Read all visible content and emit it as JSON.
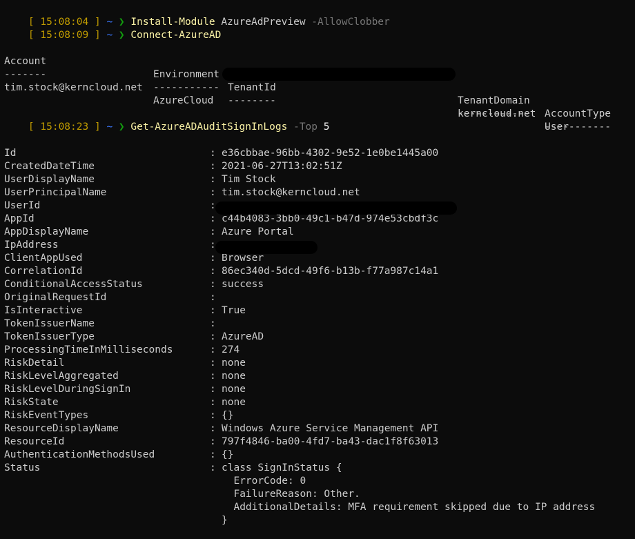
{
  "prompt": {
    "open": "[ ",
    "close": " ]",
    "tilde": "~",
    "arrow": "❯"
  },
  "commands": [
    {
      "time": "15:08:04",
      "cmdlet": "Install-Module",
      "args": "AzureAdPreview",
      "param": "-AllowClobber",
      "param_value": ""
    },
    {
      "time": "15:08:09",
      "cmdlet": "Connect-AzureAD",
      "args": "",
      "param": "",
      "param_value": ""
    },
    {
      "time": "15:08:23",
      "cmdlet": "Get-AzureADAuditSignInLogs",
      "args": "",
      "param": "-Top",
      "param_value": "5"
    }
  ],
  "account_table": {
    "headers": [
      "Account",
      "Environment",
      "TenantId",
      "TenantDomain",
      "AccountType"
    ],
    "underlines": [
      "-------",
      "-----------",
      "--------",
      "------------",
      "-----------"
    ],
    "row": [
      "tim.stock@kerncloud.net",
      "AzureCloud",
      "",
      "kerncloud.net",
      "User"
    ]
  },
  "signin": {
    "separator": ":",
    "fields": [
      {
        "key": "Id",
        "value": "e36cbbae-96bb-4302-9e52-1e0be1445a00"
      },
      {
        "key": "CreatedDateTime",
        "value": "2021-06-27T13:02:51Z"
      },
      {
        "key": "UserDisplayName",
        "value": "Tim Stock"
      },
      {
        "key": "UserPrincipalName",
        "value": "tim.stock@kerncloud.net"
      },
      {
        "key": "UserId",
        "value": ""
      },
      {
        "key": "AppId",
        "value": "c44b4083-3bb0-49c1-b47d-974e53cbdf3c"
      },
      {
        "key": "AppDisplayName",
        "value": "Azure Portal"
      },
      {
        "key": "IpAddress",
        "value": ""
      },
      {
        "key": "ClientAppUsed",
        "value": "Browser"
      },
      {
        "key": "CorrelationId",
        "value": "86ec340d-5dcd-49f6-b13b-f77a987c14a1"
      },
      {
        "key": "ConditionalAccessStatus",
        "value": "success"
      },
      {
        "key": "OriginalRequestId",
        "value": ""
      },
      {
        "key": "IsInteractive",
        "value": "True"
      },
      {
        "key": "TokenIssuerName",
        "value": ""
      },
      {
        "key": "TokenIssuerType",
        "value": "AzureAD"
      },
      {
        "key": "ProcessingTimeInMilliseconds",
        "value": "274"
      },
      {
        "key": "RiskDetail",
        "value": "none"
      },
      {
        "key": "RiskLevelAggregated",
        "value": "none"
      },
      {
        "key": "RiskLevelDuringSignIn",
        "value": "none"
      },
      {
        "key": "RiskState",
        "value": "none"
      },
      {
        "key": "RiskEventTypes",
        "value": "{}"
      },
      {
        "key": "ResourceDisplayName",
        "value": "Windows Azure Service Management API"
      },
      {
        "key": "ResourceId",
        "value": "797f4846-ba00-4fd7-ba43-dac1f8f63013"
      },
      {
        "key": "AuthenticationMethodsUsed",
        "value": "{}"
      },
      {
        "key": "Status",
        "value": "class SignInStatus {"
      }
    ],
    "status_body": [
      "  ErrorCode: 0",
      "  FailureReason: Other.",
      "  AdditionalDetails: MFA requirement skipped due to IP address",
      "}"
    ]
  },
  "colors": {
    "background": "#0c0c0c",
    "timestamp": "#c19c00",
    "tilde": "#3b78ff",
    "arrow": "#13a10e",
    "command": "#f9f1a5",
    "parameter": "#767676",
    "text": "#cccccc"
  }
}
